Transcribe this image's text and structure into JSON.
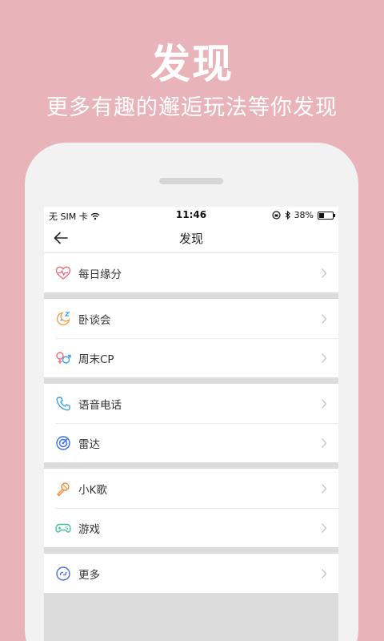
{
  "promo": {
    "title": "发现",
    "subtitle": "更多有趣的邂逅玩法等你发现"
  },
  "status_bar": {
    "carrier": "无 SIM 卡",
    "time": "11:46",
    "battery_percent": "38%",
    "battery_level": 0.38
  },
  "nav": {
    "title": "发现"
  },
  "groups": [
    {
      "items": [
        {
          "label": "每日缘分",
          "icon": "heartbeat-icon",
          "color": "#f06b7e"
        }
      ]
    },
    {
      "items": [
        {
          "label": "卧谈会",
          "icon": "moon-chat-icon",
          "color": "#f3a24a"
        },
        {
          "label": "周末CP",
          "icon": "gender-couple-icon",
          "color": "#f06b7e"
        }
      ]
    },
    {
      "items": [
        {
          "label": "语音电话",
          "icon": "phone-icon",
          "color": "#3aa0e8"
        },
        {
          "label": "雷达",
          "icon": "radar-icon",
          "color": "#3a6ee8"
        }
      ]
    },
    {
      "items": [
        {
          "label": "小K歌",
          "icon": "microphone-icon",
          "color": "#f08a3a"
        },
        {
          "label": "游戏",
          "icon": "gamepad-icon",
          "color": "#3cc3a0"
        }
      ]
    },
    {
      "items": [
        {
          "label": "更多",
          "icon": "more-icon",
          "color": "#4a6fe8"
        }
      ]
    }
  ],
  "colors": {
    "background": "#e8b3b9",
    "screen": "#efefef"
  }
}
